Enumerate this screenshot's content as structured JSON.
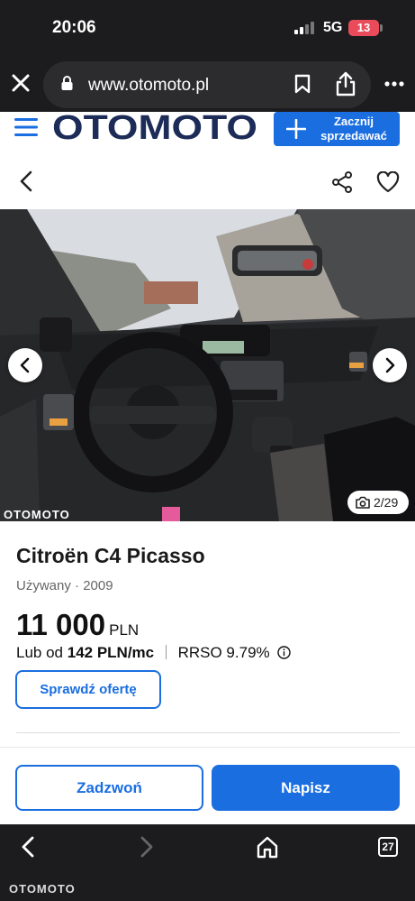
{
  "status_bar": {
    "time": "20:06",
    "network": "5G",
    "battery": "13"
  },
  "browser": {
    "url": "www.otomoto.pl",
    "tab_count": "27"
  },
  "site": {
    "logo": "OTOMOTO",
    "sell_button": {
      "line1": "Zacznij",
      "line2": "sprzedawać"
    }
  },
  "gallery": {
    "counter": "2/29",
    "watermark": "OTOMOTO"
  },
  "listing": {
    "title": "Citroën C4 Picasso",
    "condition": "Używany",
    "year": "2009",
    "price": "11 000",
    "currency": "PLN",
    "finance_prefix": "Lub od",
    "finance_amount": "142 PLN",
    "finance_suffix": "/mc",
    "rrso": "RRSO 9.79%",
    "check_offer": "Sprawdź ofertę"
  },
  "actions": {
    "call": "Zadzwoń",
    "write": "Napisz"
  },
  "footer": {
    "watermark": "OTOMOTO"
  },
  "colors": {
    "brand_blue": "#1a6ee0",
    "brand_red": "#e52b33",
    "logo_navy": "#1c2b57",
    "dark_chrome": "#1c1c1e"
  }
}
